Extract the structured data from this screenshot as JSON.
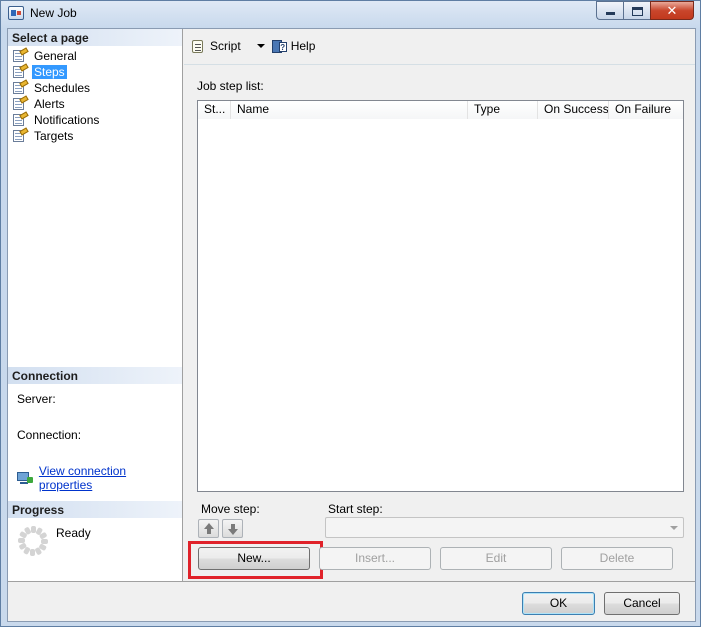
{
  "window": {
    "title": "New Job",
    "close_glyph": "✕"
  },
  "left": {
    "select_page_header": "Select a page",
    "pages": [
      {
        "label": "General",
        "selected": false
      },
      {
        "label": "Steps",
        "selected": true
      },
      {
        "label": "Schedules",
        "selected": false
      },
      {
        "label": "Alerts",
        "selected": false
      },
      {
        "label": "Notifications",
        "selected": false
      },
      {
        "label": "Targets",
        "selected": false
      }
    ],
    "connection_header": "Connection",
    "server_label": "Server:",
    "connection_label": "Connection:",
    "view_connection_link": "View connection properties",
    "progress_header": "Progress",
    "progress_status": "Ready"
  },
  "toolbar": {
    "script_label": "Script",
    "help_label": "Help"
  },
  "steps": {
    "list_label": "Job step list:",
    "columns": [
      "St...",
      "Name",
      "Type",
      "On Success",
      "On Failure"
    ],
    "move_step_label": "Move step:",
    "start_step_label": "Start step:",
    "start_step_value": "",
    "buttons": {
      "new": "New...",
      "insert": "Insert...",
      "edit": "Edit",
      "delete": "Delete"
    }
  },
  "footer": {
    "ok": "OK",
    "cancel": "Cancel"
  },
  "colors": {
    "selection": "#3399ff",
    "highlight_box": "#e0222a",
    "link": "#0033cc"
  }
}
